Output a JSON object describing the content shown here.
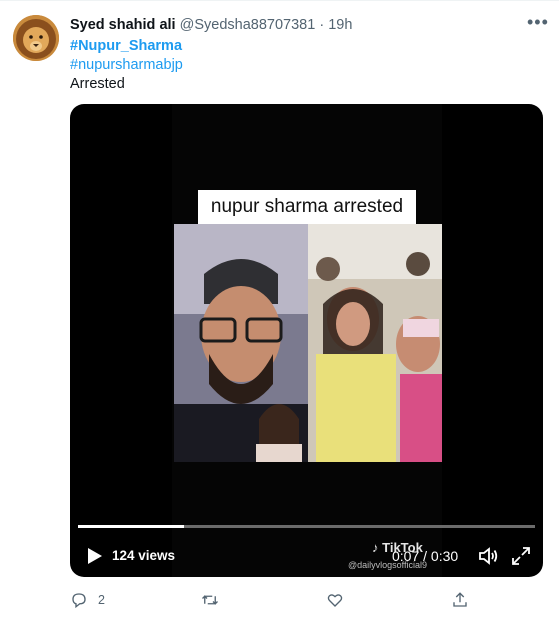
{
  "tweet": {
    "author_name": "Syed shahid ali",
    "author_handle": "@Syedsha88707381",
    "separator": "·",
    "time": "19h",
    "more_label": "•••",
    "hashtag_1": "#Nupur_Sharma",
    "hashtag_2": "#nupursharmabjp",
    "text": "Arrested"
  },
  "video": {
    "caption": "nupur sharma arrested",
    "views": "124 views",
    "timecode": "0:07 / 0:30",
    "progress": 0.233,
    "watermark_brand": "TikTok",
    "watermark_user": "@dailyvlogsofficial9"
  },
  "actions": {
    "reply_count": "2",
    "retweet_count": "",
    "like_count": ""
  },
  "colors": {
    "accent": "#1d9bf0",
    "muted": "#536471",
    "media_bg": "#000000"
  },
  "icons": [
    "lion-avatar",
    "more-icon",
    "play-icon",
    "volume-icon",
    "fullscreen-icon",
    "tiktok-icon",
    "reply-icon",
    "retweet-icon",
    "like-icon",
    "share-icon"
  ]
}
